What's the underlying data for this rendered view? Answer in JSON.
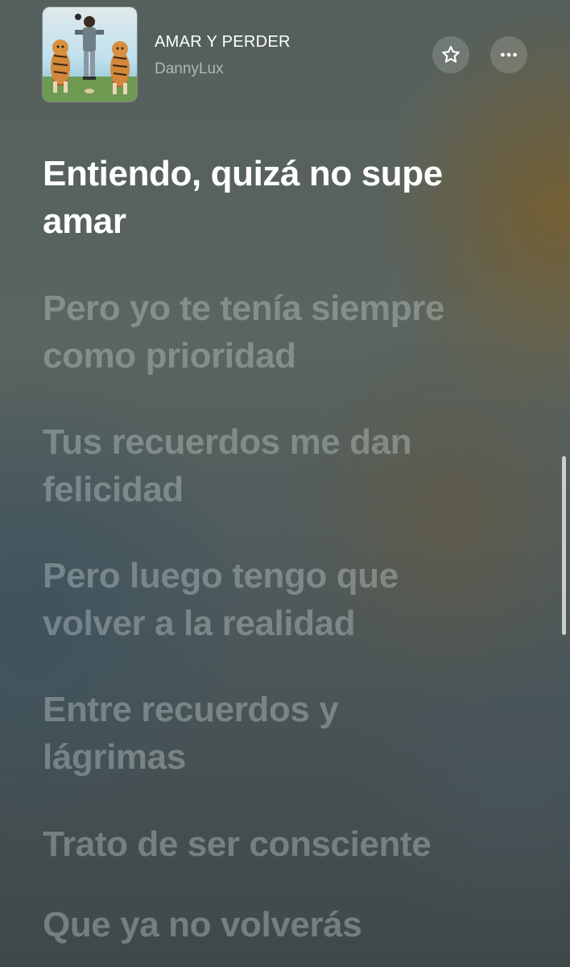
{
  "now_playing": {
    "title": "AMAR Y PERDER",
    "artist": "DannyLux"
  },
  "controls": {
    "favorite_icon": "star-outline-icon",
    "more_icon": "ellipsis-icon"
  },
  "lyrics": {
    "lines": [
      "Entiendo, quizá no supe\namar",
      "Pero yo te tenía siempre\ncomo prioridad",
      "Tus recuerdos me dan\nfelicidad",
      "Pero luego tengo que\nvolver a la realidad",
      "Entre recuerdos y\nlágrimas",
      "Trato de ser consciente",
      "Que ya no volverás"
    ],
    "active_index": 0
  },
  "colors": {
    "active_lyric": "#ffffff",
    "inactive_lyric": "rgba(190,200,200,0.42)"
  }
}
